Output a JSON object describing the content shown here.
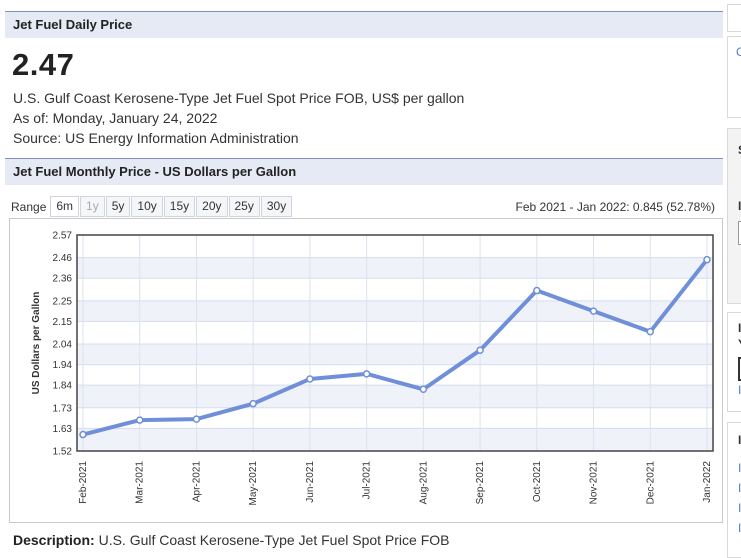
{
  "daily": {
    "header": "Jet Fuel Daily Price",
    "price": "2.47",
    "description": "U.S. Gulf Coast Kerosene-Type Jet Fuel Spot Price FOB, US$ per gallon",
    "as_of": "As of: Monday, January 24, 2022",
    "source": "Source: US Energy Information Administration"
  },
  "monthly": {
    "header": "Jet Fuel Monthly Price - US Dollars per Gallon",
    "range_label": "Range",
    "ranges": [
      "6m",
      "1y",
      "5y",
      "10y",
      "15y",
      "20y",
      "25y",
      "30y"
    ],
    "range_summary": "Feb 2021 - Jan 2022: 0.845 (52.78%)",
    "description_label": "Description:",
    "description_text": "U.S. Gulf Coast Kerosene-Type Jet Fuel Spot Price FOB"
  },
  "colors": {
    "line": "#6f8fd8",
    "header_bg": "#e5eaf5",
    "header_border": "#7d92c2"
  },
  "chart_data": {
    "type": "line",
    "ylabel": "US Dollars per Gallon",
    "xlabel": "",
    "title": "",
    "categories": [
      "Feb-2021",
      "Mar-2021",
      "Apr-2021",
      "May-2021",
      "Jun-2021",
      "Jul-2021",
      "Aug-2021",
      "Sep-2021",
      "Oct-2021",
      "Nov-2021",
      "Dec-2021",
      "Jan-2022"
    ],
    "series": [
      {
        "values": [
          1.6,
          1.67,
          1.675,
          1.75,
          1.87,
          1.895,
          1.82,
          2.01,
          2.3,
          2.2,
          2.1,
          2.45
        ]
      }
    ],
    "yticks": [
      "1.52",
      "1.63",
      "1.73",
      "1.84",
      "1.94",
      "2.04",
      "2.15",
      "2.25",
      "2.36",
      "2.46",
      "2.57"
    ],
    "ylim": [
      1.52,
      2.57
    ],
    "grid": true,
    "legend": "none"
  },
  "sidebar": {
    "letters": [
      "C",
      "S",
      "I",
      "I",
      "Y",
      "I",
      "I",
      "I",
      "I",
      "I",
      "I"
    ]
  }
}
